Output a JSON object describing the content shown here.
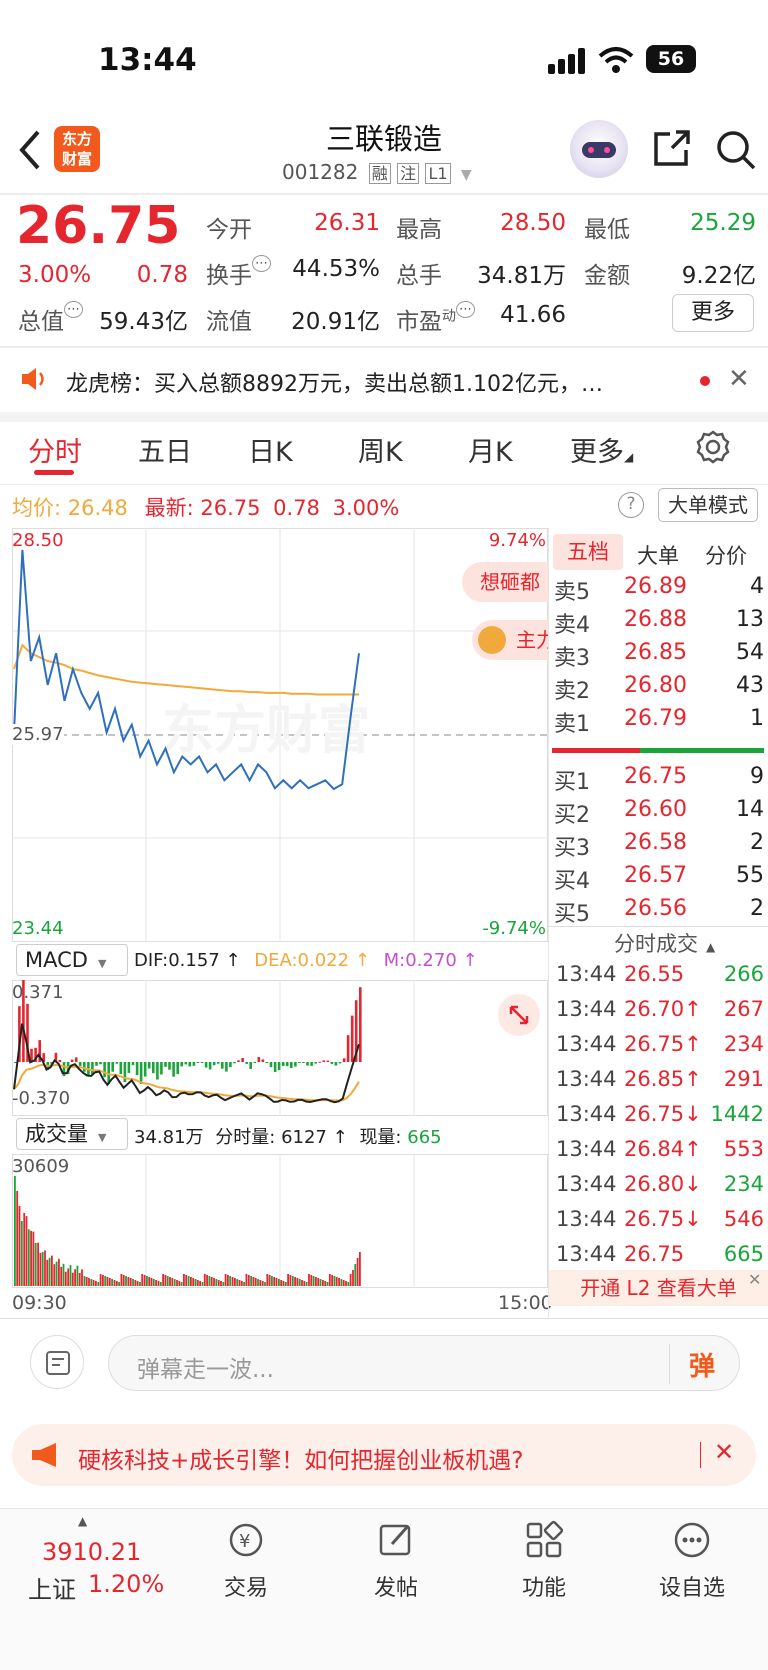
{
  "status_bar": {
    "time": "13:44",
    "battery": "56"
  },
  "header": {
    "logo_line1": "东方",
    "logo_line2": "财富",
    "stock_name": "三联锻造",
    "stock_code": "001282",
    "tags": [
      "融",
      "注",
      "L1"
    ]
  },
  "quote": {
    "price": "26.75",
    "change_pct": "3.00%",
    "change": "0.78",
    "open_label": "今开",
    "open": "26.31",
    "high_label": "最高",
    "high": "28.50",
    "low_label": "最低",
    "low": "25.29",
    "turnover_label": "换手",
    "turnover": "44.53%",
    "volume_label": "总手",
    "volume": "34.81万",
    "amount_label": "金额",
    "amount": "9.22亿",
    "mktcap_label": "总值",
    "mktcap": "59.43亿",
    "float_label": "流值",
    "float": "20.91亿",
    "pe_label": "市盈",
    "pe_sup": "动",
    "pe": "41.66",
    "more_label": "更多"
  },
  "notice": {
    "text": "龙虎榜：买入总额8892万元，卖出总额1.102亿元，…"
  },
  "tabs": [
    "分时",
    "五日",
    "日K",
    "周K",
    "月K",
    "更多"
  ],
  "chart_header": {
    "avg_label": "均价:",
    "avg": "26.48",
    "latest_label": "最新:",
    "latest": "26.75",
    "chg": "0.78",
    "pct": "3.00%",
    "mode_button": "大单模式"
  },
  "chart_labels": {
    "y_top": "28.50",
    "y_mid": "25.97",
    "y_bot": "23.44",
    "pct_top": "9.74%",
    "pct_bot": "-9.74%",
    "bubble1": "想砸都",
    "bubble2": "主力",
    "watermark": "东方财富",
    "time_start": "09:30",
    "time_end": "15:00"
  },
  "macd": {
    "name": "MACD",
    "dif": "DIF:0.157 ↑",
    "dea": "DEA:0.022 ↑",
    "m": "M:0.270 ↑",
    "top": "0.371",
    "bot": "-0.370"
  },
  "vol_panel": {
    "name": "成交量",
    "total": "34.81万",
    "minute_label": "分时量:",
    "minute": "6127 ↑",
    "now_label": "现量:",
    "now": "665",
    "max": "30609"
  },
  "chart_data": {
    "type": "line",
    "title": "",
    "x": [
      "09:30",
      "15:00"
    ],
    "ylim": [
      23.44,
      28.5
    ],
    "base": 25.97,
    "series": [
      {
        "name": "",
        "color": "#2f6fbf",
        "values": [
          26.0,
          28.3,
          26.9,
          27.2,
          26.6,
          27.0,
          26.4,
          26.8,
          26.5,
          26.3,
          26.5,
          26.0,
          26.3,
          25.9,
          26.1,
          25.7,
          25.9,
          25.6,
          25.8,
          25.5,
          25.7,
          25.6,
          25.7,
          25.5,
          25.6,
          25.4,
          25.5,
          25.6,
          25.4,
          25.6,
          25.5,
          25.3,
          25.4,
          25.3,
          25.4,
          25.3,
          25.35,
          25.4,
          25.29,
          25.35,
          26.2,
          27.0
        ]
      },
      {
        "name": "均价",
        "color": "#f2a93b",
        "values": [
          26.8,
          27.1,
          27.0,
          26.95,
          26.9,
          26.88,
          26.85,
          26.8,
          26.78,
          26.75,
          26.72,
          26.7,
          26.68,
          26.66,
          26.64,
          26.63,
          26.62,
          26.61,
          26.6,
          26.59,
          26.58,
          26.57,
          26.56,
          26.55,
          26.54,
          26.53,
          26.52,
          26.52,
          26.51,
          26.51,
          26.5,
          26.5,
          26.5,
          26.49,
          26.49,
          26.49,
          26.48,
          26.48,
          26.48,
          26.48,
          26.48,
          26.48
        ]
      }
    ]
  },
  "order_book": {
    "tabs": [
      "五档",
      "大单",
      "分价"
    ],
    "asks": [
      {
        "label": "卖5",
        "price": "26.89",
        "vol": "4"
      },
      {
        "label": "卖4",
        "price": "26.88",
        "vol": "13"
      },
      {
        "label": "卖3",
        "price": "26.85",
        "vol": "54"
      },
      {
        "label": "卖2",
        "price": "26.80",
        "vol": "43"
      },
      {
        "label": "卖1",
        "price": "26.79",
        "vol": "1"
      }
    ],
    "bids": [
      {
        "label": "买1",
        "price": "26.75",
        "vol": "9"
      },
      {
        "label": "买2",
        "price": "26.60",
        "vol": "14"
      },
      {
        "label": "买3",
        "price": "26.58",
        "vol": "2"
      },
      {
        "label": "买4",
        "price": "26.57",
        "vol": "55"
      },
      {
        "label": "买5",
        "price": "26.56",
        "vol": "2"
      }
    ]
  },
  "trades": {
    "title": "分时成交",
    "rows": [
      {
        "time": "13:44",
        "price": "26.55",
        "vol": "266",
        "pc": "#e6262f",
        "vc": "#1aa53a"
      },
      {
        "time": "13:44",
        "price": "26.70↑",
        "vol": "267",
        "pc": "#e6262f",
        "vc": "#e6262f"
      },
      {
        "time": "13:44",
        "price": "26.75↑",
        "vol": "234",
        "pc": "#e6262f",
        "vc": "#e6262f"
      },
      {
        "time": "13:44",
        "price": "26.85↑",
        "vol": "291",
        "pc": "#e6262f",
        "vc": "#e6262f"
      },
      {
        "time": "13:44",
        "price": "26.75↓",
        "vol": "1442",
        "pc": "#e6262f",
        "vc": "#1aa53a"
      },
      {
        "time": "13:44",
        "price": "26.84↑",
        "vol": "553",
        "pc": "#e6262f",
        "vc": "#e6262f"
      },
      {
        "time": "13:44",
        "price": "26.80↓",
        "vol": "234",
        "pc": "#e6262f",
        "vc": "#1aa53a"
      },
      {
        "time": "13:44",
        "price": "26.75↓",
        "vol": "546",
        "pc": "#e6262f",
        "vc": "#e6262f"
      },
      {
        "time": "13:44",
        "price": "26.75",
        "vol": "665",
        "pc": "#e6262f",
        "vc": "#1aa53a"
      }
    ],
    "l2_banner": "开通 L2 查看大单"
  },
  "comment": {
    "placeholder": "弹幕走一波...",
    "send": "弹"
  },
  "ad": {
    "text": "硬核科技+成长引擎！如何把握创业板机遇?"
  },
  "bottom_nav": {
    "index_value": "3910.21",
    "index_name": "上证",
    "index_pct": "1.20%",
    "items": [
      "交易",
      "发帖",
      "功能",
      "设自选"
    ]
  }
}
